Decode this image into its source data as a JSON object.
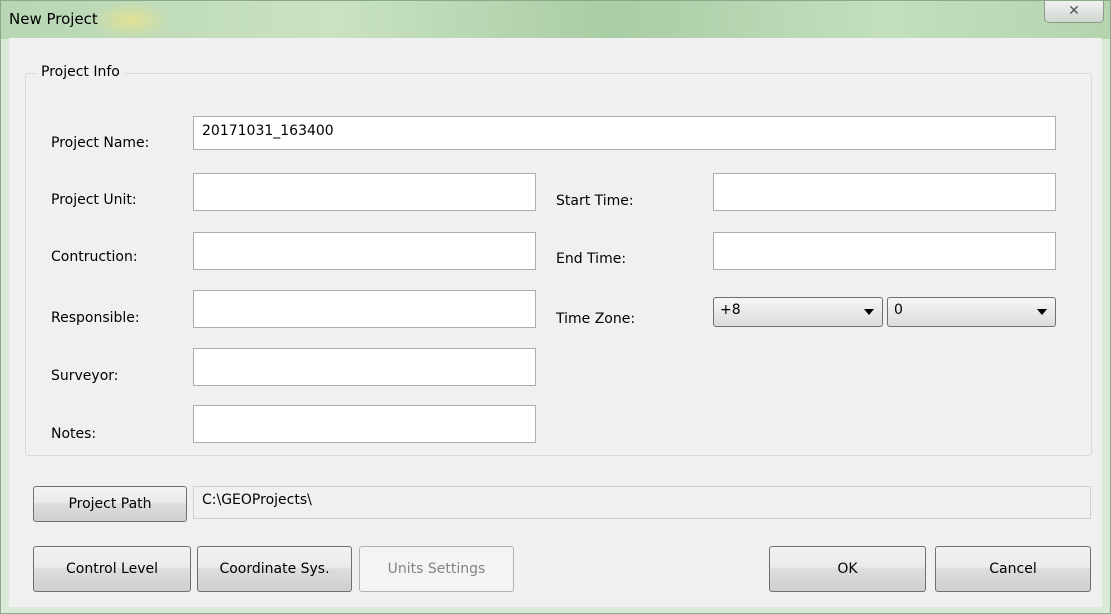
{
  "window": {
    "title": "New Project",
    "close_glyph": "✕"
  },
  "group": {
    "title": "Project Info"
  },
  "fields": {
    "project_name": {
      "label": "Project Name:",
      "value": "20171031_163400"
    },
    "project_unit": {
      "label": "Project Unit:",
      "value": ""
    },
    "construction": {
      "label": "Contruction:",
      "value": ""
    },
    "responsible": {
      "label": "Responsible:",
      "value": ""
    },
    "surveyor": {
      "label": "Surveyor:",
      "value": ""
    },
    "notes": {
      "label": "Notes:",
      "value": ""
    },
    "start_time": {
      "label": "Start Time:",
      "value": ""
    },
    "end_time": {
      "label": "End Time:",
      "value": ""
    },
    "time_zone": {
      "label": "Time Zone:",
      "hours": "+8",
      "minutes": "0"
    }
  },
  "path": {
    "button_label": "Project Path",
    "value": "C:\\GEOProjects\\"
  },
  "buttons": {
    "control_level": "Control Level",
    "coordinate_sys": "Coordinate Sys.",
    "units_settings": "Units Settings",
    "ok": "OK",
    "cancel": "Cancel"
  }
}
